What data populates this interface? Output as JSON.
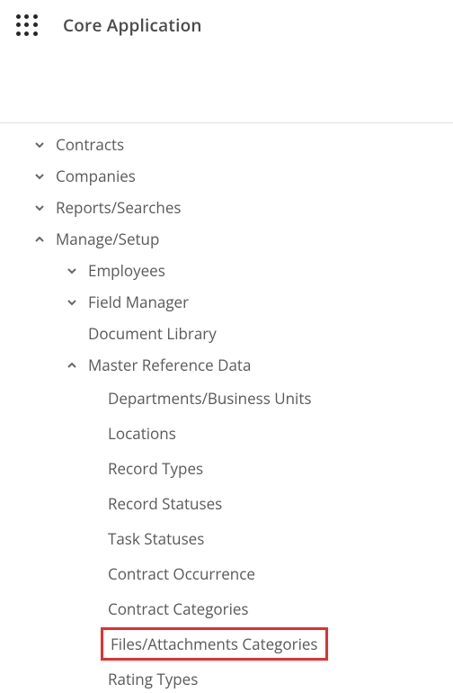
{
  "header": {
    "title": "Core Application"
  },
  "nav": {
    "items": [
      {
        "label": "Contracts",
        "expanded": false
      },
      {
        "label": "Companies",
        "expanded": false
      },
      {
        "label": "Reports/Searches",
        "expanded": false
      },
      {
        "label": "Manage/Setup",
        "expanded": true,
        "children": [
          {
            "label": "Employees",
            "expanded": false
          },
          {
            "label": "Field Manager",
            "expanded": false
          },
          {
            "label": "Document Library"
          },
          {
            "label": "Master Reference Data",
            "expanded": true,
            "children": [
              {
                "label": "Departments/Business Units"
              },
              {
                "label": "Locations"
              },
              {
                "label": "Record Types"
              },
              {
                "label": "Record Statuses"
              },
              {
                "label": "Task Statuses"
              },
              {
                "label": "Contract Occurrence"
              },
              {
                "label": "Contract Categories"
              },
              {
                "label": "Files/Attachments Categories",
                "highlighted": true
              },
              {
                "label": "Rating Types"
              }
            ]
          }
        ]
      }
    ]
  }
}
